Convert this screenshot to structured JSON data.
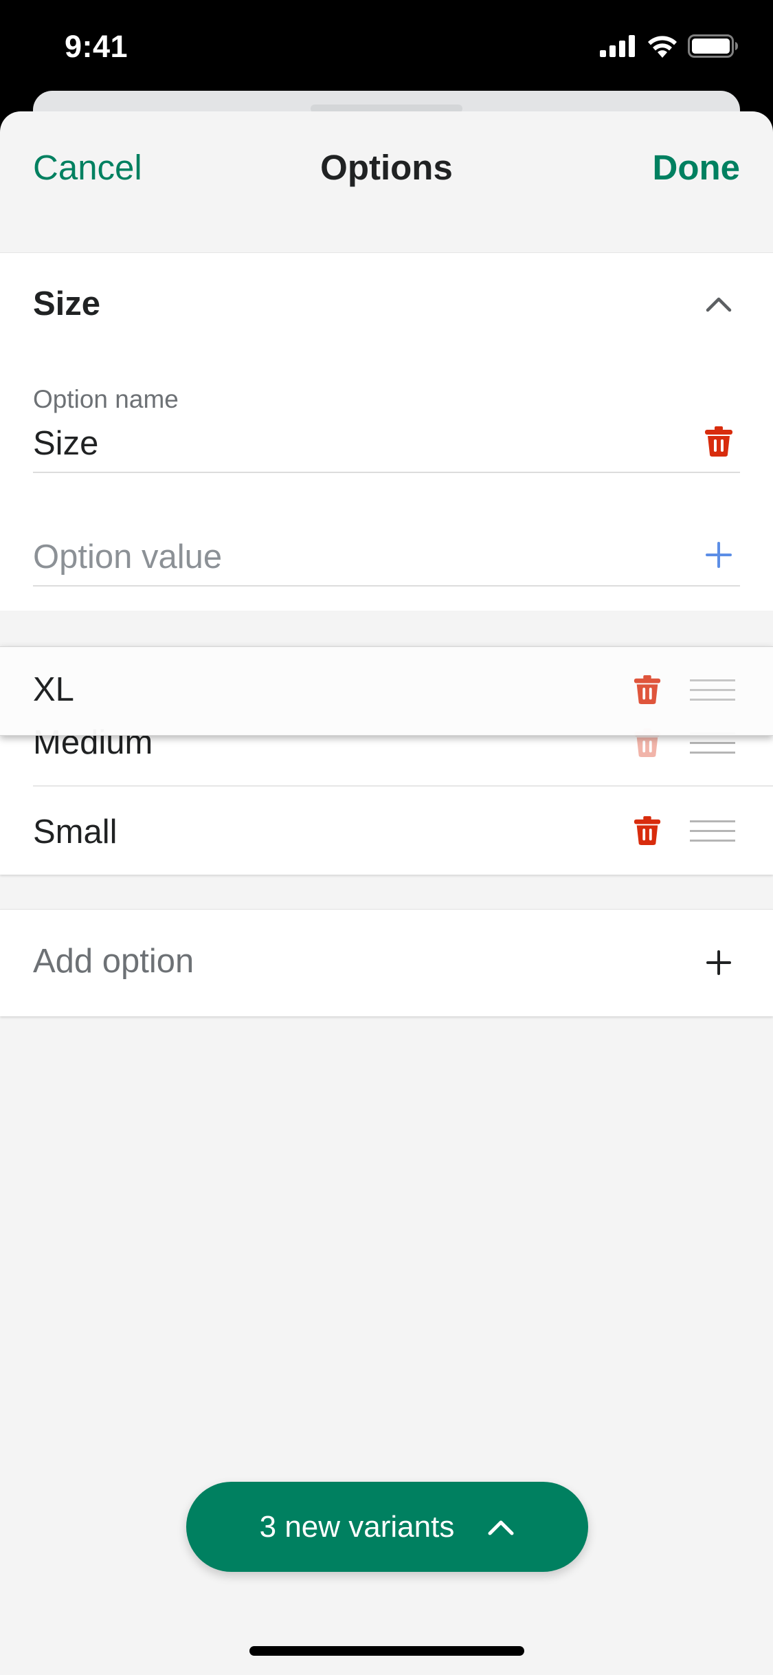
{
  "status_bar": {
    "time": "9:41",
    "icons": [
      "cellular-signal-icon",
      "wifi-icon",
      "battery-icon"
    ]
  },
  "nav": {
    "cancel_label": "Cancel",
    "title": "Options",
    "done_label": "Done"
  },
  "option_section": {
    "title": "Size",
    "collapse_icon": "chevron-up-icon",
    "name_field": {
      "label": "Option name",
      "value": "Size",
      "delete_icon": "trash-icon"
    },
    "value_field": {
      "placeholder": "Option value",
      "add_icon": "plus-icon"
    },
    "values": [
      {
        "label": "XL",
        "state": "dragging"
      },
      {
        "label": "Medium"
      },
      {
        "label": "Small"
      }
    ]
  },
  "add_option": {
    "label": "Add option",
    "icon": "plus-icon"
  },
  "variants_button": {
    "label": "3 new variants",
    "icon": "chevron-up-icon"
  },
  "colors": {
    "brand_green": "#008060",
    "destructive_red": "#d82c0d",
    "link_blue": "#5c8ee6",
    "background": "#f4f4f4"
  }
}
